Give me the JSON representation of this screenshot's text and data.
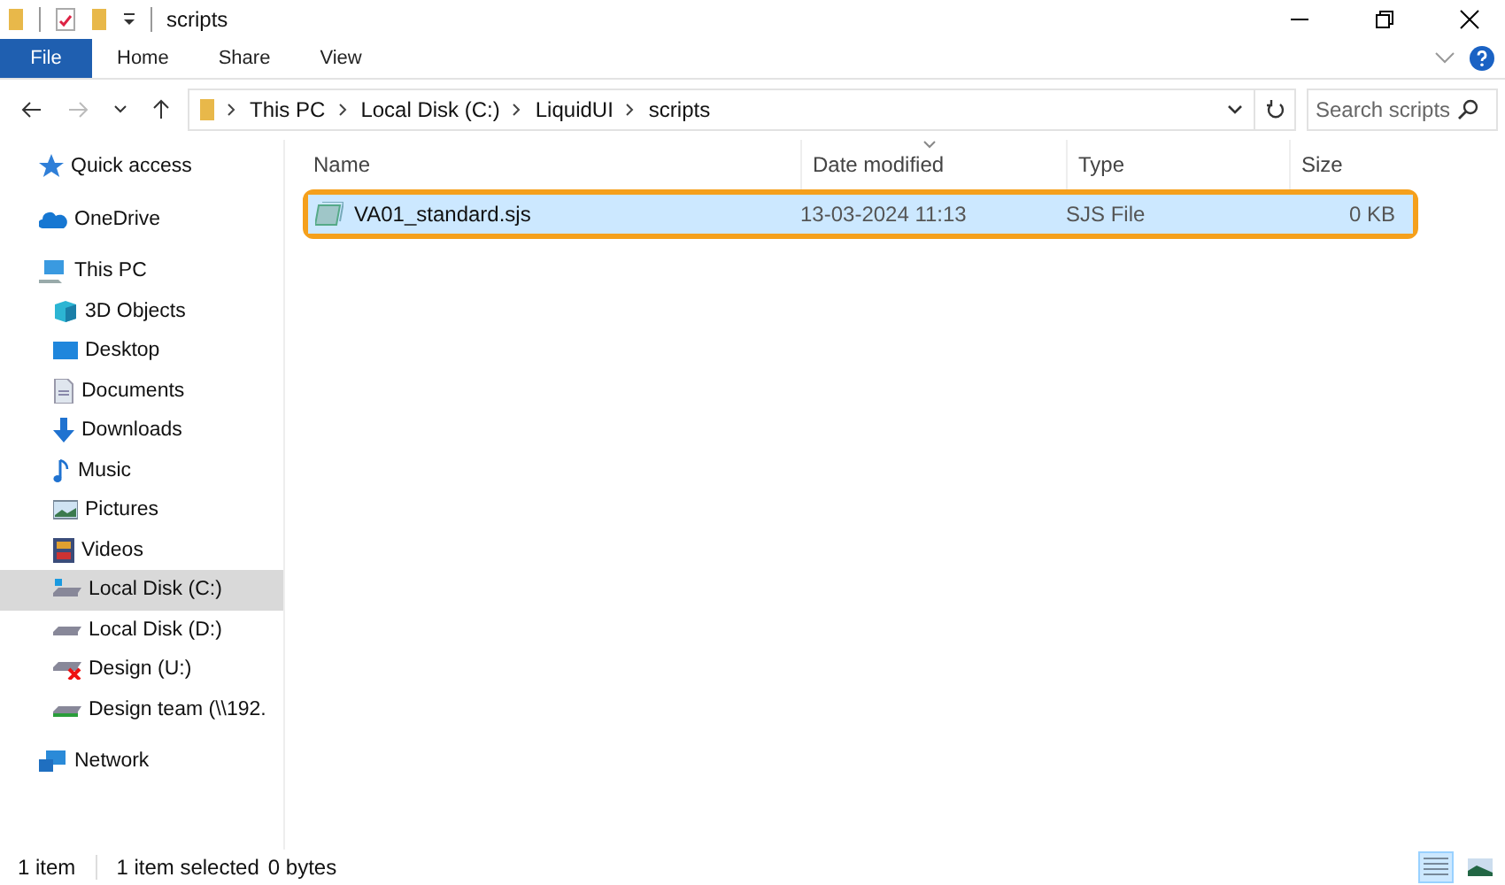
{
  "window": {
    "title": "scripts"
  },
  "ribbon_tabs": [
    {
      "label": "File",
      "kind": "file"
    },
    {
      "label": "Home",
      "kind": "tab"
    },
    {
      "label": "Share",
      "kind": "tab"
    },
    {
      "label": "View",
      "kind": "tab"
    }
  ],
  "address_bar": {
    "crumbs": [
      "This PC",
      "Local Disk (C:)",
      "LiquidUI",
      "scripts"
    ]
  },
  "search": {
    "placeholder": "Search scripts"
  },
  "sidebar": {
    "items": [
      {
        "label": "Quick access",
        "selected": false
      },
      {
        "label": "OneDrive",
        "selected": false
      },
      {
        "label": "This PC",
        "selected": false,
        "children": [
          {
            "label": "3D Objects",
            "selected": false
          },
          {
            "label": "Desktop",
            "selected": false
          },
          {
            "label": "Documents",
            "selected": false
          },
          {
            "label": "Downloads",
            "selected": false
          },
          {
            "label": "Music",
            "selected": false
          },
          {
            "label": "Pictures",
            "selected": false
          },
          {
            "label": "Videos",
            "selected": false
          },
          {
            "label": "Local Disk (C:)",
            "selected": true
          },
          {
            "label": "Local Disk (D:)",
            "selected": false
          },
          {
            "label": "Design (U:)",
            "selected": false
          },
          {
            "label": "Design team (\\\\192.",
            "selected": false
          }
        ]
      },
      {
        "label": "Network",
        "selected": false
      }
    ]
  },
  "table": {
    "columns": [
      {
        "label": "Name",
        "sorted": false
      },
      {
        "label": "Date modified",
        "sorted": true
      },
      {
        "label": "Type",
        "sorted": false
      },
      {
        "label": "Size",
        "sorted": false
      }
    ],
    "rows": [
      {
        "name": "VA01_standard.sjs",
        "date": "13-03-2024 11:13",
        "type": "SJS File",
        "size": "0 KB",
        "selected": true
      }
    ]
  },
  "status_bar": {
    "count": "1 item",
    "selection": "1 item selected",
    "size": "0 bytes"
  }
}
